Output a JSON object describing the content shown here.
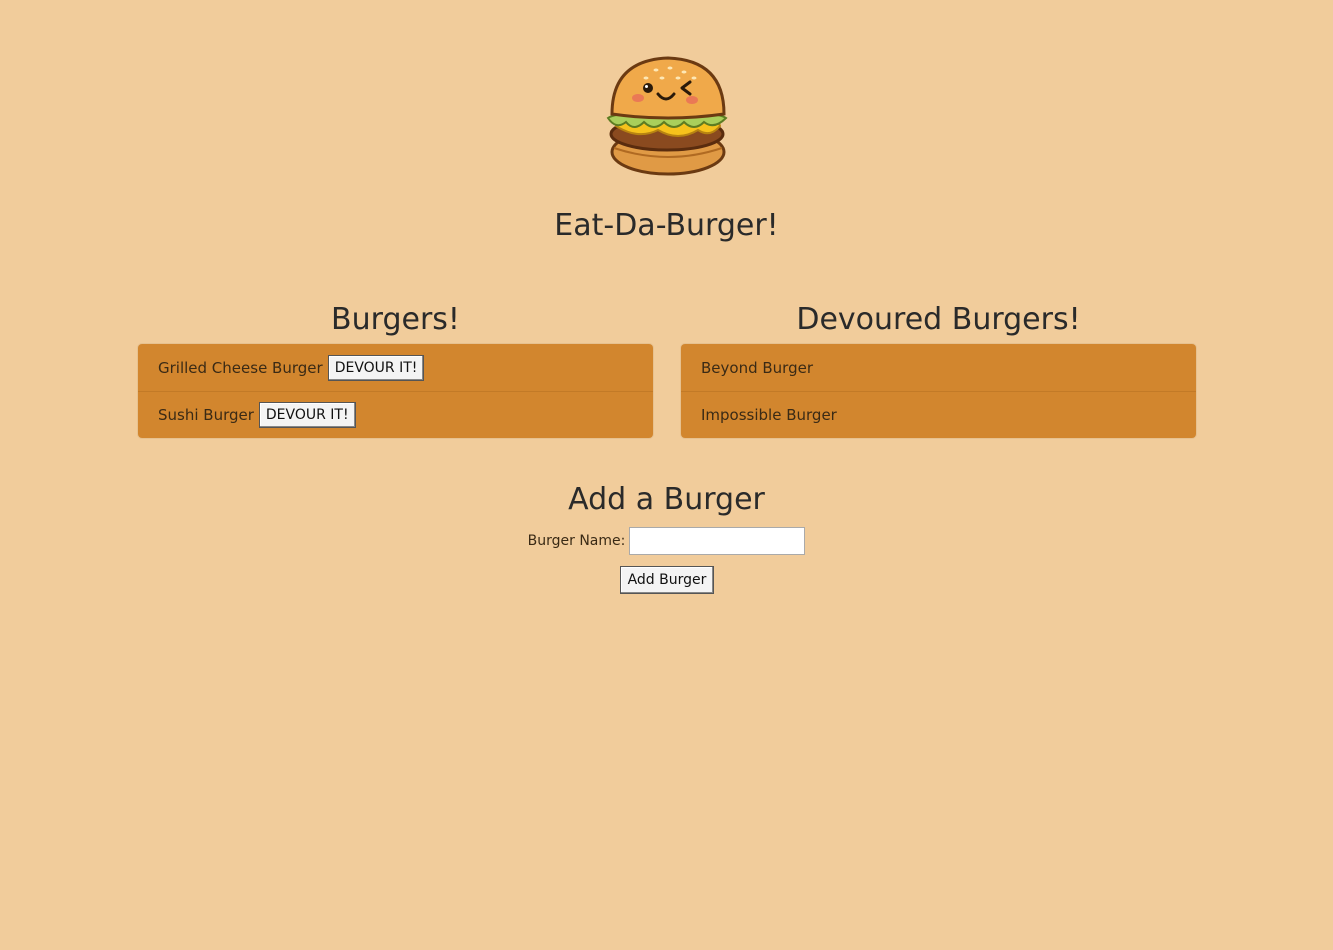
{
  "header": {
    "logo_icon": "winking-burger-icon",
    "title": "Eat-Da-Burger!"
  },
  "burgers": {
    "title": "Burgers!",
    "items": [
      {
        "name": "Grilled Cheese Burger",
        "button_label": "DEVOUR IT!"
      },
      {
        "name": "Sushi Burger",
        "button_label": "DEVOUR IT!"
      }
    ]
  },
  "devoured": {
    "title": "Devoured Burgers!",
    "items": [
      {
        "name": "Beyond Burger"
      },
      {
        "name": "Impossible Burger"
      }
    ]
  },
  "add_form": {
    "title": "Add a Burger",
    "label": "Burger Name:",
    "input_value": "",
    "submit_label": "Add Burger"
  },
  "colors": {
    "background": "#f1cc9b",
    "list_background": "#d2862e",
    "text": "#2a2a2a"
  }
}
